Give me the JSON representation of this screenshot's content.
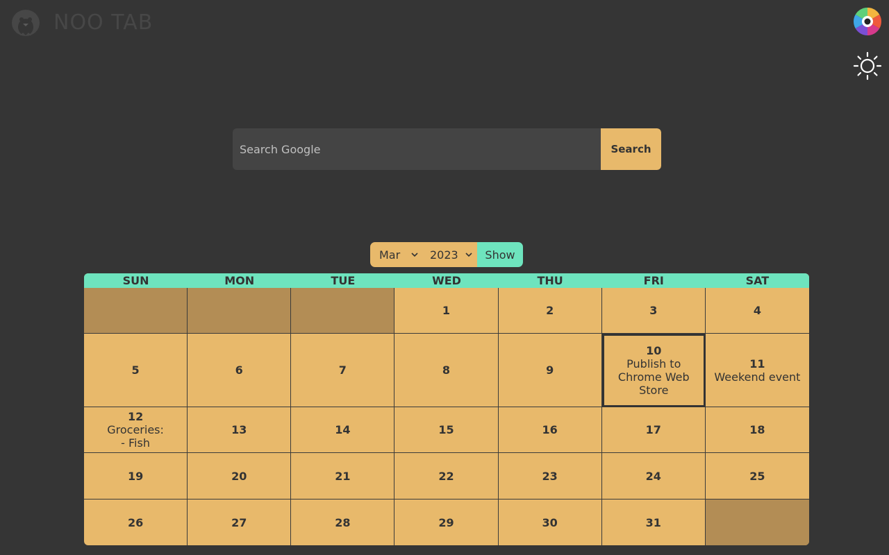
{
  "app": {
    "logo_text": "NOO TAB",
    "logo_icon": "penguin-icon"
  },
  "toolbar": {
    "color_icon": "color-wheel-icon",
    "theme_icon": "sun-icon"
  },
  "search": {
    "placeholder": "Search Google",
    "value": "",
    "button_label": "Search"
  },
  "picker": {
    "month": "Mar",
    "year": "2023",
    "show_label": "Show"
  },
  "calendar": {
    "weekdays": [
      "SUN",
      "MON",
      "TUE",
      "WED",
      "THU",
      "FRI",
      "SAT"
    ],
    "cells": [
      {
        "day": "",
        "events": [],
        "empty": true
      },
      {
        "day": "",
        "events": [],
        "empty": true
      },
      {
        "day": "",
        "events": [],
        "empty": true
      },
      {
        "day": "1",
        "events": []
      },
      {
        "day": "2",
        "events": []
      },
      {
        "day": "3",
        "events": []
      },
      {
        "day": "4",
        "events": []
      },
      {
        "day": "5",
        "events": []
      },
      {
        "day": "6",
        "events": []
      },
      {
        "day": "7",
        "events": []
      },
      {
        "day": "8",
        "events": []
      },
      {
        "day": "9",
        "events": []
      },
      {
        "day": "10",
        "events": [
          "Publish to",
          "Chrome Web",
          "Store"
        ],
        "today": true
      },
      {
        "day": "11",
        "events": [
          "Weekend event"
        ]
      },
      {
        "day": "12",
        "events": [
          "Groceries:",
          "- Fish"
        ]
      },
      {
        "day": "13",
        "events": []
      },
      {
        "day": "14",
        "events": []
      },
      {
        "day": "15",
        "events": []
      },
      {
        "day": "16",
        "events": []
      },
      {
        "day": "17",
        "events": []
      },
      {
        "day": "18",
        "events": []
      },
      {
        "day": "19",
        "events": []
      },
      {
        "day": "20",
        "events": []
      },
      {
        "day": "21",
        "events": []
      },
      {
        "day": "22",
        "events": []
      },
      {
        "day": "23",
        "events": []
      },
      {
        "day": "24",
        "events": []
      },
      {
        "day": "25",
        "events": []
      },
      {
        "day": "26",
        "events": []
      },
      {
        "day": "27",
        "events": []
      },
      {
        "day": "28",
        "events": []
      },
      {
        "day": "29",
        "events": []
      },
      {
        "day": "30",
        "events": []
      },
      {
        "day": "31",
        "events": []
      },
      {
        "day": "",
        "events": [],
        "empty": true
      }
    ]
  },
  "colors": {
    "background": "#353535",
    "accent": "#e8b96b",
    "accent_dim": "#b38d55",
    "teal": "#6ee4be"
  }
}
